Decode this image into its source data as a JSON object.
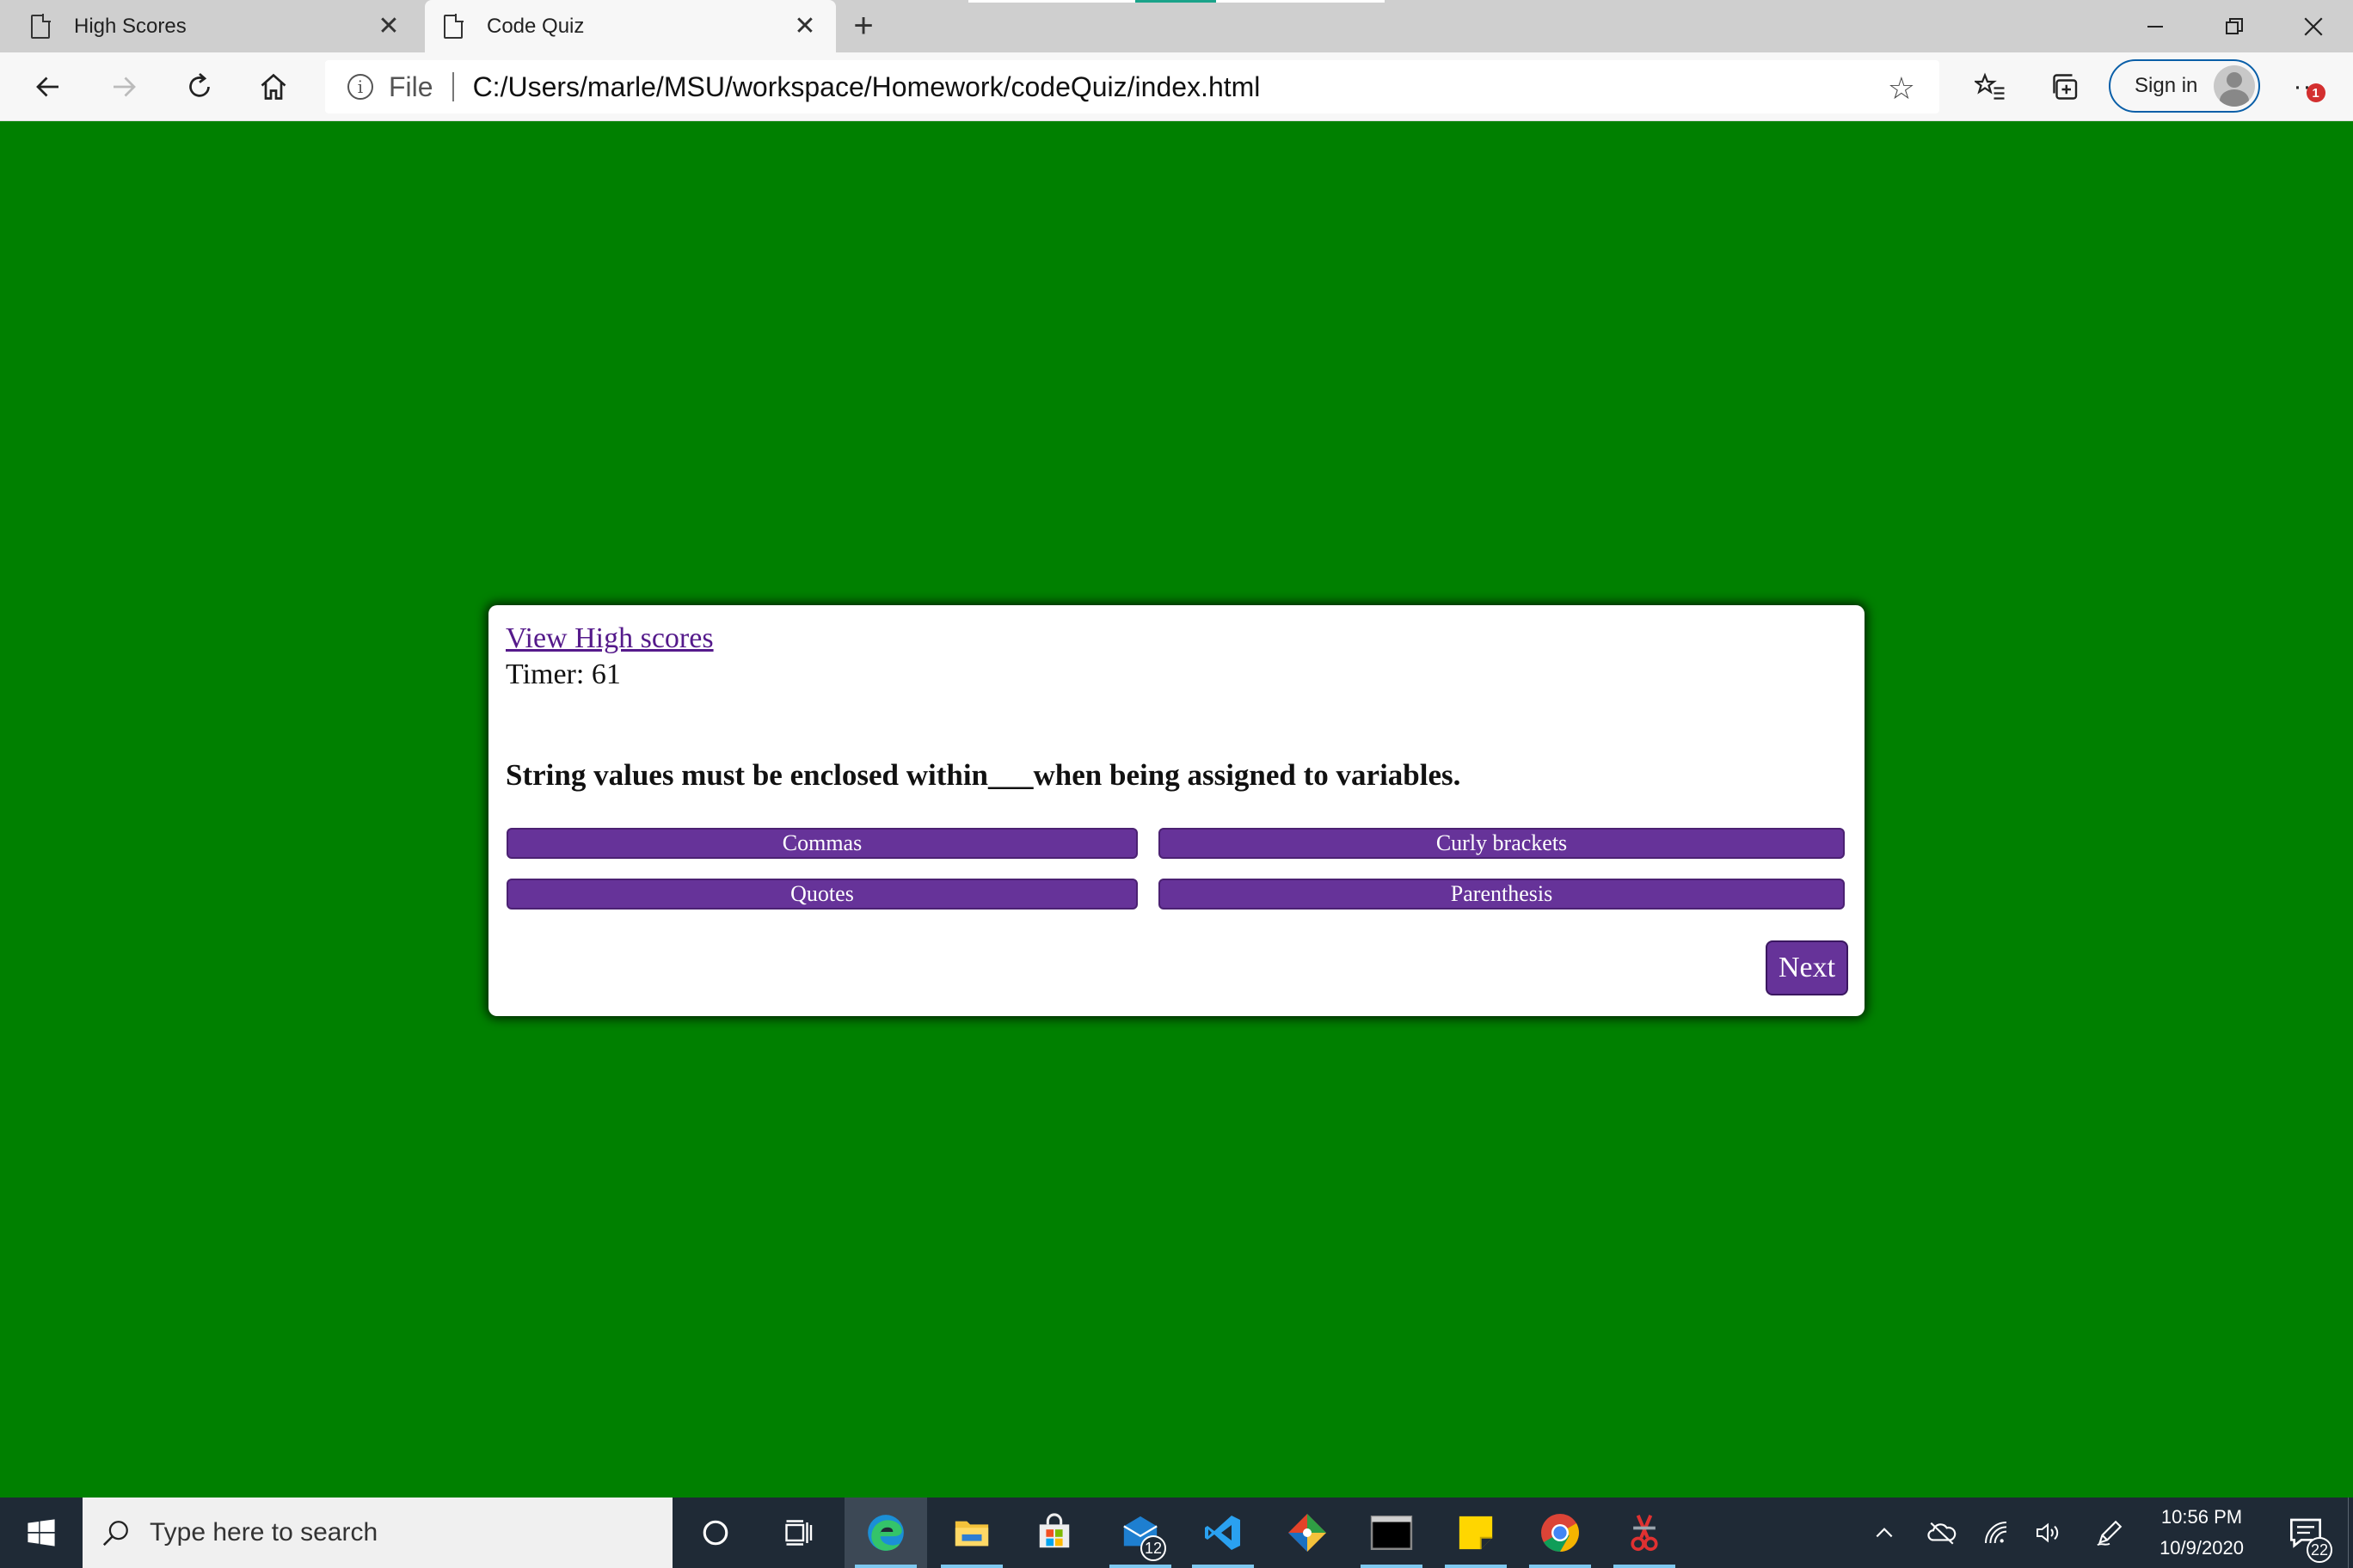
{
  "browser": {
    "tabs": [
      {
        "title": "High Scores",
        "active": false
      },
      {
        "title": "Code Quiz",
        "active": true
      }
    ],
    "new_tab_symbol": "+",
    "close_symbol": "✕",
    "address": {
      "protocol_label": "File",
      "url": "C:/Users/marle/MSU/workspace/Homework/codeQuiz/index.html"
    },
    "sign_in_label": "Sign in",
    "more_symbol": "···",
    "notification_badge": "1",
    "window_controls": {
      "minimize": "—",
      "restore": "❐",
      "close": "✕"
    }
  },
  "quiz": {
    "high_scores_link": "View High scores",
    "timer_text": "Timer: 61",
    "question": "String values must be enclosed within___when being assigned to variables.",
    "answers": [
      "Commas",
      "Curly brackets",
      "Quotes",
      "Parenthesis"
    ],
    "next_label": "Next"
  },
  "taskbar": {
    "search_placeholder": "Type here to search",
    "apps": [
      {
        "name": "cortana-icon"
      },
      {
        "name": "task-view-icon"
      },
      {
        "name": "edge-icon",
        "active": true
      },
      {
        "name": "file-explorer-icon"
      },
      {
        "name": "store-icon"
      },
      {
        "name": "mail-icon",
        "badge": "12"
      },
      {
        "name": "vscode-icon"
      },
      {
        "name": "git-icon"
      },
      {
        "name": "terminal-icon"
      },
      {
        "name": "sticky-notes-icon"
      },
      {
        "name": "chrome-icon"
      },
      {
        "name": "snipping-tool-icon"
      }
    ],
    "time": "10:56 PM",
    "date": "10/9/2020",
    "notification_count": "22"
  },
  "colors": {
    "page_background": "#008000",
    "button_purple": "#663399",
    "link_purple": "#551a8b",
    "taskbar": "#1f2a36",
    "signin_border": "#0a5fa8"
  }
}
